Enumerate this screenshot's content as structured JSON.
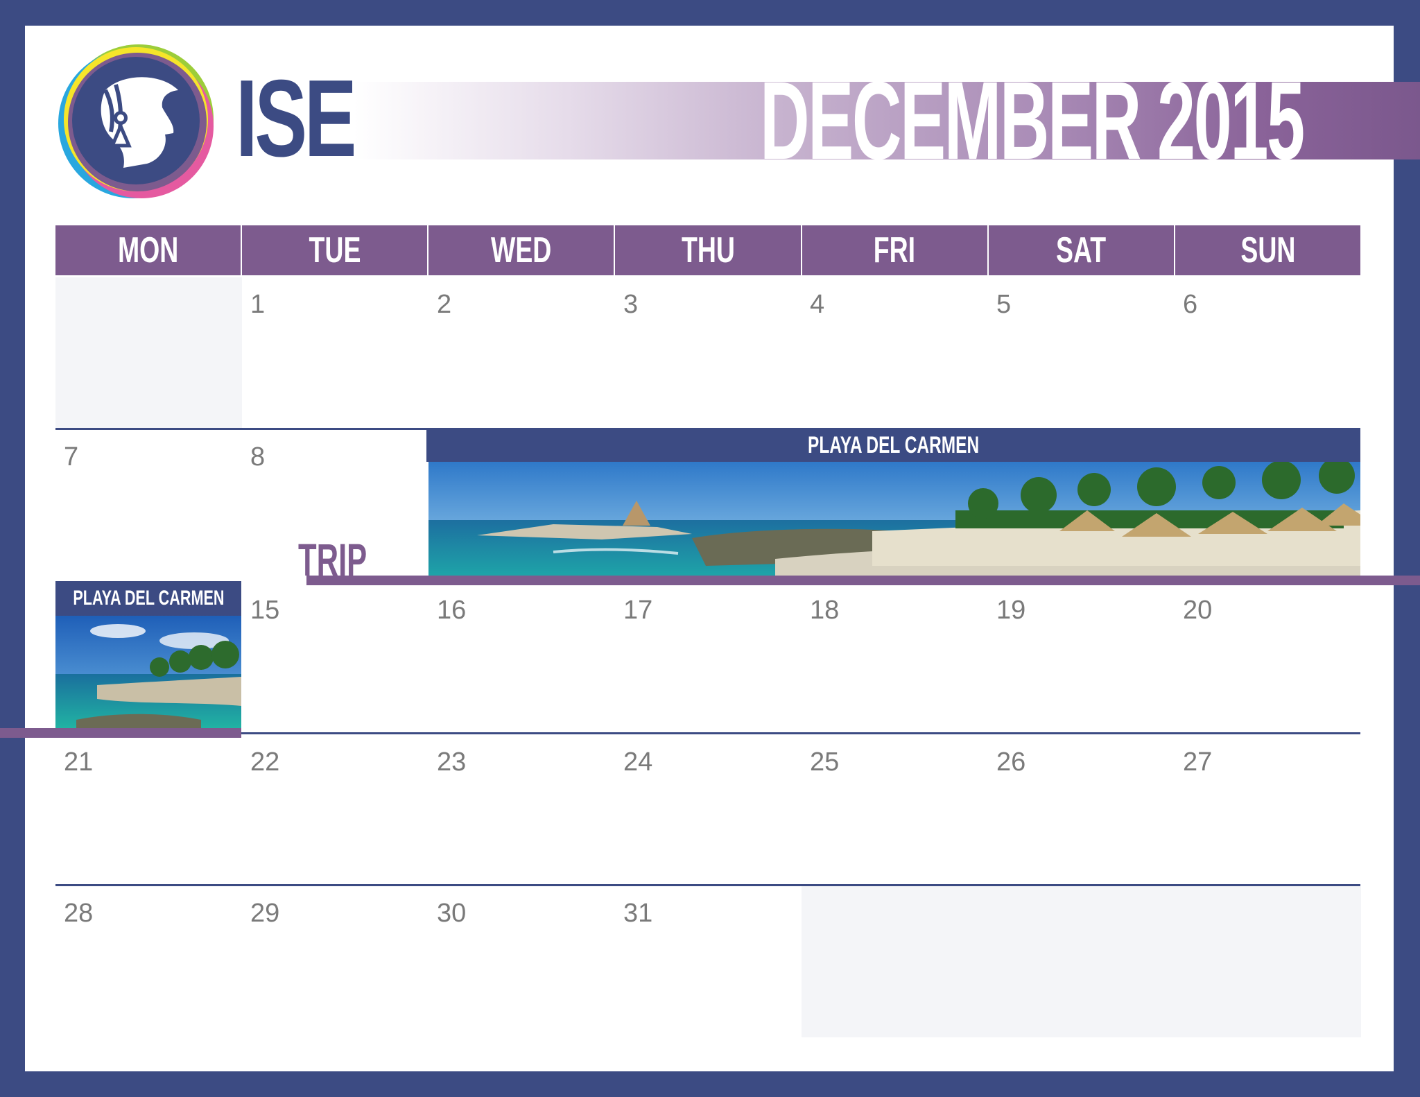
{
  "header": {
    "brand": "ISE",
    "month_title": "DECEMBER 2015"
  },
  "weekdays": [
    "MON",
    "TUE",
    "WED",
    "THU",
    "FRI",
    "SAT",
    "SUN"
  ],
  "weeks": [
    [
      "",
      "1",
      "2",
      "3",
      "4",
      "5",
      "6"
    ],
    [
      "7",
      "8",
      "",
      "",
      "",
      "",
      ""
    ],
    [
      "",
      "15",
      "16",
      "17",
      "18",
      "19",
      "20"
    ],
    [
      "21",
      "22",
      "23",
      "24",
      "25",
      "26",
      "27"
    ],
    [
      "28",
      "29",
      "30",
      "31",
      "",
      "",
      ""
    ]
  ],
  "events": {
    "trip_label": "TRIP",
    "banner_main": "PLAYA DEL CARMEN",
    "banner_small": "PLAYA DEL CARMEN"
  },
  "colors": {
    "navy": "#3c4b83",
    "purple": "#7d5b8e",
    "blank_cell": "#f4f5f8"
  }
}
